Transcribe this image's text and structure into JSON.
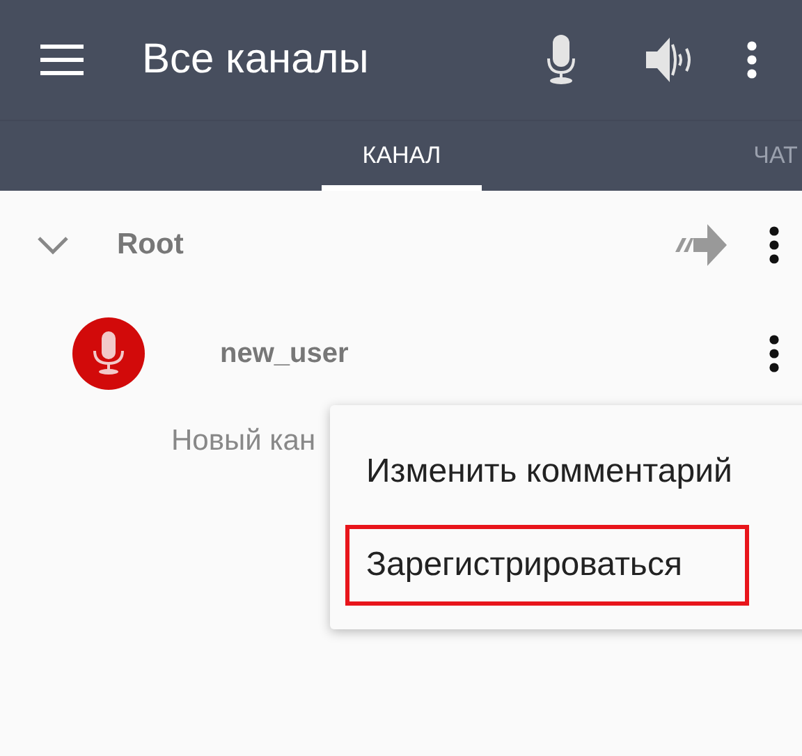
{
  "app_bar": {
    "title": "Все каналы"
  },
  "tabs": [
    {
      "label": "КАНАЛ",
      "selected": true
    },
    {
      "label": "ЧАТ",
      "selected": false
    }
  ],
  "tree": {
    "name": "Root",
    "expanded": true,
    "users": [
      {
        "name": "new_user",
        "talking": true
      }
    ],
    "placeholder_text": "Новый кан"
  },
  "context_menu": [
    {
      "label": "Изменить комментарий",
      "highlighted": false
    },
    {
      "label": "Зарегистрироваться",
      "highlighted": true
    }
  ]
}
